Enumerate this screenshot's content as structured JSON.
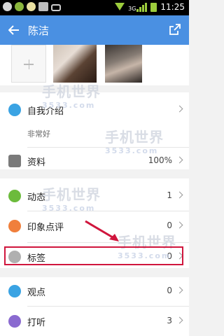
{
  "status_bar": {
    "time": "11:25",
    "network": "3G"
  },
  "header": {
    "title": "陈洁"
  },
  "sections": {
    "intro": {
      "label": "自我介绍",
      "subtext": "非常好"
    },
    "profile": {
      "label": "资料",
      "value": "100%"
    },
    "activity": {
      "label": "动态",
      "value": "1"
    },
    "impression": {
      "label": "印象点评",
      "value": "0"
    },
    "tags": {
      "label": "标签",
      "value": "0"
    },
    "opinion": {
      "label": "观点",
      "value": "0"
    },
    "inquire": {
      "label": "打听",
      "value": "3"
    }
  },
  "watermark": {
    "brand": "手机世界",
    "domain": "3533.com"
  },
  "colors": {
    "action_bar": "#4a90e2",
    "intro_icon": "#3aa3e3",
    "profile_icon": "#7a7a7a",
    "activity_icon": "#6cbb3c",
    "impression_icon": "#f07f3c",
    "tags_icon": "#b0b0b0",
    "opinion_icon": "#3aa3e3",
    "inquire_icon": "#8a6ad0",
    "highlight": "#d0163d"
  }
}
